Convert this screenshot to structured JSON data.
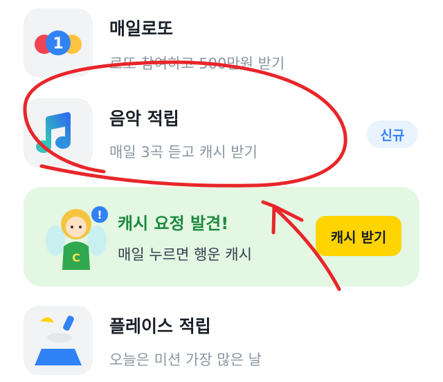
{
  "items": [
    {
      "title": "매일로또",
      "subtitle": "로또 참여하고 500만원 받기",
      "icon": "lotto-balls-icon"
    },
    {
      "title": "음악 적립",
      "subtitle": "매일 3곡 듣고 캐시 받기",
      "icon": "music-note-icon",
      "badge": "신규"
    },
    {
      "title": "플레이스 적립",
      "subtitle": "오늘은 미션 가장 많은 날",
      "icon": "place-shapes-icon"
    }
  ],
  "promo": {
    "title": "캐시 요정 발견!",
    "subtitle": "매일 누르면 행운 캐시",
    "button_label": "캐시 받기",
    "icon": "cash-fairy-icon",
    "fairy_badge": "!",
    "fairy_letter": "C"
  },
  "lotto_number": "1",
  "colors": {
    "promo_bg": "#e3f7e3",
    "promo_title": "#1d8a3c",
    "button": "#ffd400",
    "badge_bg": "#e8f3ff",
    "badge_text": "#3182f6",
    "annotation": "#e8262a"
  }
}
